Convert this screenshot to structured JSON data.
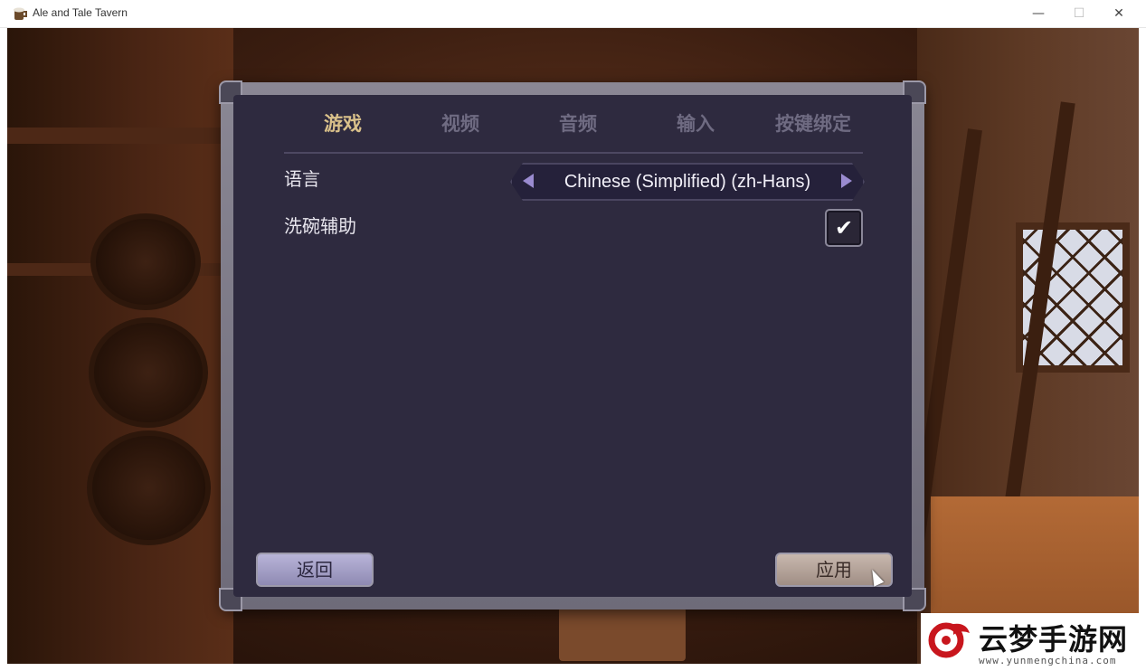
{
  "window": {
    "title": "Ale and Tale Tavern",
    "icon": "tavern-mug-icon",
    "controls": [
      "minimize",
      "maximize",
      "close"
    ],
    "minimize_glyph": "—",
    "maximize_glyph": "☐",
    "close_glyph": "✕"
  },
  "settings": {
    "tabs": [
      {
        "label": "游戏",
        "active": true
      },
      {
        "label": "视频",
        "active": false
      },
      {
        "label": "音频",
        "active": false
      },
      {
        "label": "输入",
        "active": false
      },
      {
        "label": "按键绑定",
        "active": false
      }
    ],
    "language": {
      "label": "语言",
      "value": "Chinese (Simplified) (zh-Hans)"
    },
    "dishwashing_assist": {
      "label": "洗碗辅助",
      "checked": true,
      "check_glyph": "✔"
    },
    "back_button": "返回",
    "apply_button": "应用"
  },
  "colors": {
    "active_tab": "#d9c08a",
    "inactive_tab": "#6f6b82",
    "panel_bg": "#2e2a3f",
    "arrow": "#9a8bd0"
  },
  "watermark": {
    "title": "云梦手游网",
    "url": "www.yunmengchina.com"
  }
}
